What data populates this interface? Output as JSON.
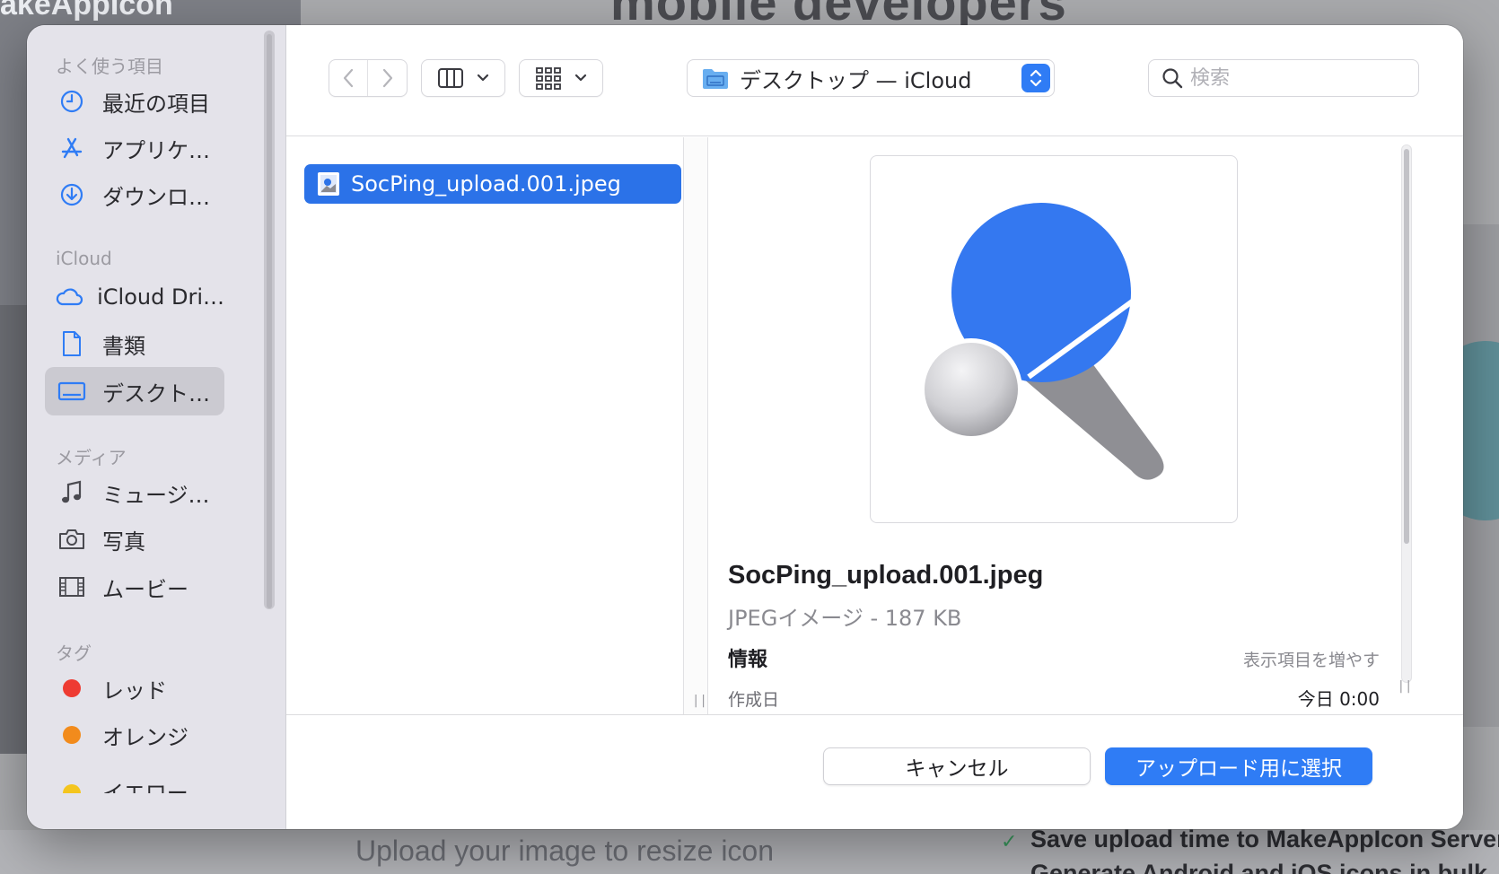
{
  "background": {
    "logo": "akeAppIcon",
    "headline": "mobile developers",
    "upload_text": "Upload your image to resize icon",
    "feature_1": "Save upload time to MakeAppIcon Server",
    "feature_2": "Generate Android and iOS icons in bulk"
  },
  "sidebar": {
    "favorites_title": "よく使う項目",
    "favorites": [
      {
        "label": "最近の項目",
        "icon": "clock-icon"
      },
      {
        "label": "アプリケ…",
        "icon": "applications-icon"
      },
      {
        "label": "ダウンロ…",
        "icon": "download-icon"
      }
    ],
    "icloud_title": "iCloud",
    "icloud": [
      {
        "label": "iCloud Dri…",
        "icon": "cloud-icon"
      },
      {
        "label": "書類",
        "icon": "document-icon"
      },
      {
        "label": "デスクト…",
        "icon": "desktop-icon",
        "active": true
      }
    ],
    "media_title": "メディア",
    "media": [
      {
        "label": "ミュージ…",
        "icon": "music-icon"
      },
      {
        "label": "写真",
        "icon": "camera-icon"
      },
      {
        "label": "ムービー",
        "icon": "film-icon"
      }
    ],
    "tags_title": "タグ",
    "tags": [
      {
        "label": "レッド",
        "color": "#ee3b32"
      },
      {
        "label": "オレンジ",
        "color": "#f28b1c"
      },
      {
        "label": "イエロー",
        "color": "#f4c51e"
      }
    ]
  },
  "toolbar": {
    "location": "デスクトップ — iCloud",
    "search_placeholder": "検索"
  },
  "files": [
    {
      "name": "SocPing_upload.001.jpeg",
      "selected": true
    }
  ],
  "preview": {
    "file_name": "SocPing_upload.001.jpeg",
    "kind": "JPEGイメージ - 187 KB",
    "info_title": "情報",
    "show_more": "表示項目を増やす",
    "created_label": "作成日",
    "created_value": "今日 0:00"
  },
  "buttons": {
    "cancel": "キャンセル",
    "select": "アップロード用に選択"
  },
  "colors": {
    "accent": "#2f7cf5",
    "selection": "#2b72e8",
    "paddle_blue": "#3478f0",
    "paddle_handle": "#8f8f94"
  }
}
